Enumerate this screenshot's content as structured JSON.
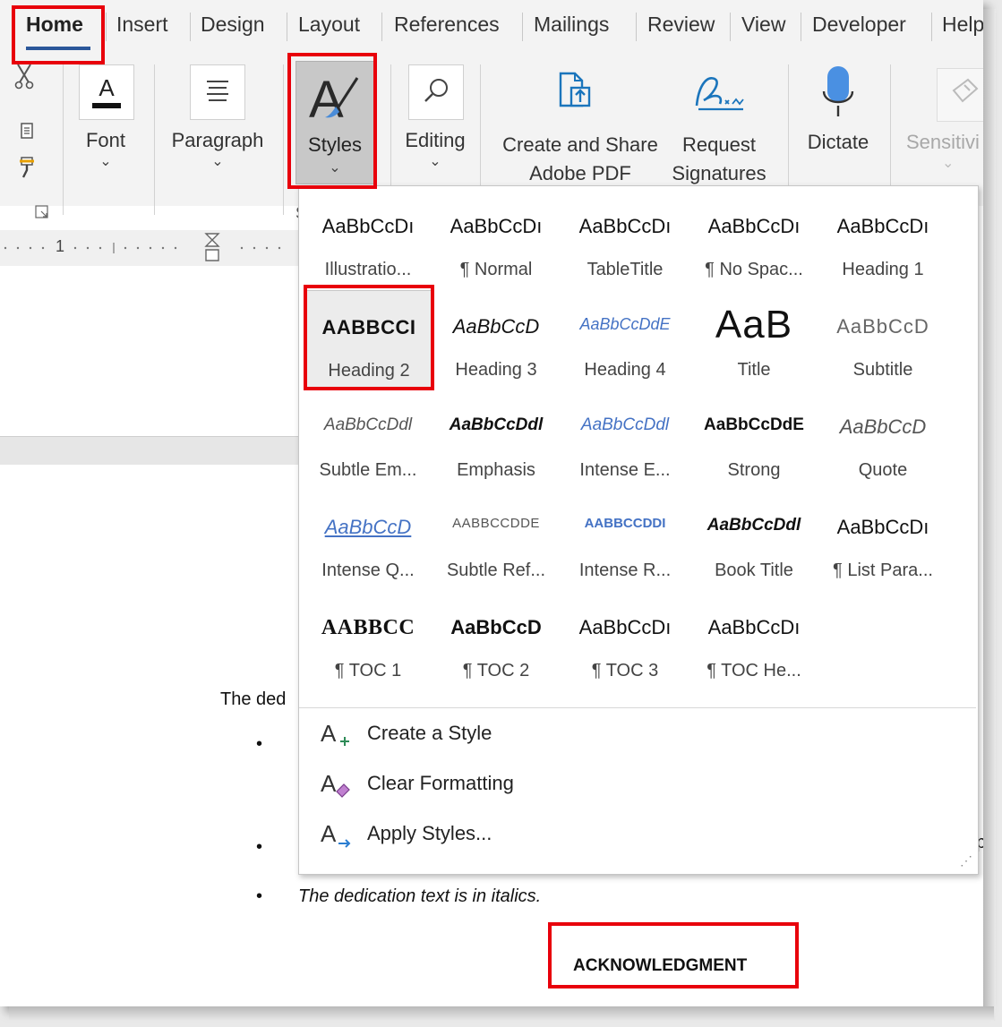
{
  "tabs": [
    "Home",
    "Insert",
    "Design",
    "Layout",
    "References",
    "Mailings",
    "Review",
    "View",
    "Developer",
    "Help"
  ],
  "ribbon": {
    "font_label": "Font",
    "paragraph_label": "Paragraph",
    "styles_label": "Styles",
    "editing_label": "Editing",
    "adobe_label_1": "Create and Share",
    "adobe_label_2": "Adobe PDF",
    "request_label_1": "Request",
    "request_label_2": "Signatures",
    "dictate_label": "Dictate",
    "sensitivity_label": "Sensitivi",
    "group_letter": "S",
    "chevron": "⌄",
    "ruler_number": "1"
  },
  "styles_gallery": [
    {
      "preview": "AaBbCcDı",
      "name": "Illustratio...",
      "style": "normal"
    },
    {
      "preview": "AaBbCcDı",
      "name": "¶ Normal",
      "style": "normal"
    },
    {
      "preview": "AaBbCcDı",
      "name": "TableTitle",
      "style": "normal"
    },
    {
      "preview": "AaBbCcDı",
      "name": "¶ No Spac...",
      "style": "normal"
    },
    {
      "preview": "AaBbCcDı",
      "name": "Heading 1",
      "style": "normal"
    },
    {
      "preview": "AABBCCI",
      "name": "Heading 2",
      "style": "h2"
    },
    {
      "preview": "AaBbCcD",
      "name": "Heading 3",
      "style": "italic"
    },
    {
      "preview": "AaBbCcDdE",
      "name": "Heading 4",
      "style": "h4"
    },
    {
      "preview": "AaB",
      "name": "Title",
      "style": "title"
    },
    {
      "preview": "AaBbCcD",
      "name": "Subtitle",
      "style": "subtitle"
    },
    {
      "preview": "AaBbCcDdl",
      "name": "Subtle Em...",
      "style": "subtle-em"
    },
    {
      "preview": "AaBbCcDdl",
      "name": "Emphasis",
      "style": "emphasis"
    },
    {
      "preview": "AaBbCcDdl",
      "name": "Intense E...",
      "style": "intense-e"
    },
    {
      "preview": "AaBbCcDdE",
      "name": "Strong",
      "style": "strong"
    },
    {
      "preview": "AaBbCcD",
      "name": "Quote",
      "style": "quote"
    },
    {
      "preview": "AaBbCcD",
      "name": "Intense Q...",
      "style": "intense-q"
    },
    {
      "preview": "AABBCCDDE",
      "name": "Subtle Ref...",
      "style": "subtle-ref"
    },
    {
      "preview": "AABBCCDDI",
      "name": "Intense R...",
      "style": "intense-r"
    },
    {
      "preview": "AaBbCcDdl",
      "name": "Book Title",
      "style": "book"
    },
    {
      "preview": "AaBbCcDı",
      "name": "¶ List Para...",
      "style": "normal"
    },
    {
      "preview": "AABBCC",
      "name": "¶ TOC 1",
      "style": "toc1"
    },
    {
      "preview": "AaBbCcD",
      "name": "¶ TOC 2",
      "style": "toc2"
    },
    {
      "preview": "AaBbCcDı",
      "name": "¶ TOC 3",
      "style": "normal"
    },
    {
      "preview": "AaBbCcDı",
      "name": "¶ TOC He...",
      "style": "normal"
    }
  ],
  "menu": {
    "create_style": "Create a Style",
    "clear_formatting": "Clear Formatting",
    "apply_styles": "Apply Styles..."
  },
  "document": {
    "partial_line": "The ded",
    "bullet_char": "•",
    "right_fragment": "p",
    "italic_bullet": "The dedication text is in italics.",
    "heading": "ACKNOWLEDGMENT"
  },
  "colors": {
    "highlight": "#e8000b",
    "accent_blue": "#2b579a",
    "heading_blue": "#4472c4"
  }
}
